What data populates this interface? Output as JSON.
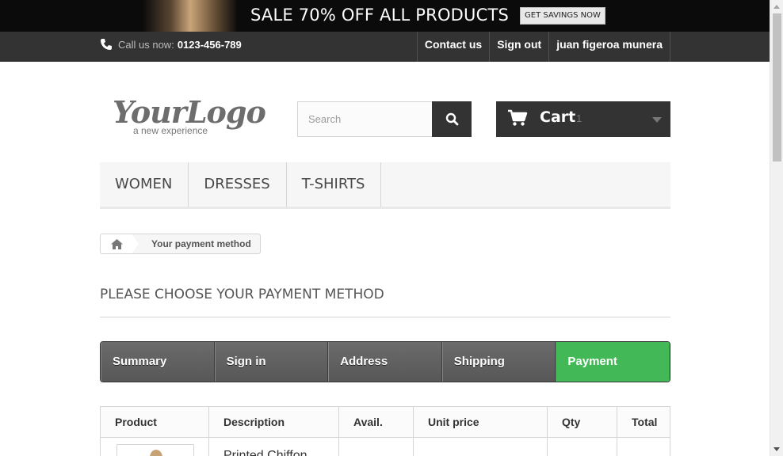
{
  "banner": {
    "headline": "SALE 70% OFF ALL PRODUCTS",
    "button_label": "GET SAVINGS NOW"
  },
  "nav": {
    "phone_prefix": "Call us now:",
    "phone_number": "0123-456-789",
    "links": [
      {
        "label": "Contact us"
      },
      {
        "label": "Sign out"
      },
      {
        "label": "juan figeroa munera"
      }
    ]
  },
  "header": {
    "logo_main": "YourLogo",
    "logo_sub": "a new experience",
    "search_placeholder": "Search",
    "cart_label": "Cart",
    "cart_count": "1"
  },
  "menu": {
    "items": [
      {
        "label": "WOMEN"
      },
      {
        "label": "DRESSES"
      },
      {
        "label": "T-SHIRTS"
      }
    ]
  },
  "breadcrumb": {
    "current": "Your payment method"
  },
  "page": {
    "heading": "PLEASE CHOOSE YOUR PAYMENT METHOD"
  },
  "steps": [
    {
      "label": "Summary",
      "active": false
    },
    {
      "label": "Sign in",
      "active": false
    },
    {
      "label": "Address",
      "active": false
    },
    {
      "label": "Shipping",
      "active": false
    },
    {
      "label": "Payment",
      "active": true
    }
  ],
  "table": {
    "headers": [
      "Product",
      "Description",
      "Avail.",
      "Unit price",
      "Qty",
      "Total"
    ],
    "rows": [
      {
        "description": "Printed Chiffon"
      }
    ]
  },
  "colors": {
    "active_step": "#42b856",
    "dark_bar": "#333333"
  }
}
